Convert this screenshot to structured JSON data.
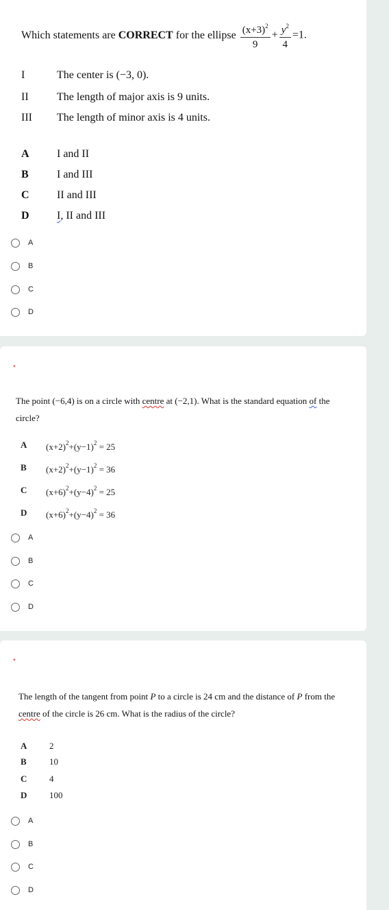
{
  "questions": [
    {
      "prompt_prefix": "Which statements are ",
      "prompt_bold": "CORRECT",
      "prompt_suffix": " for the ellipse",
      "equation": {
        "term1_num": "(x+3)",
        "term1_exp": "2",
        "term1_den": "9",
        "plus": "+",
        "term2_num": "y",
        "term2_exp": "2",
        "term2_den": "4",
        "rhs": "=1."
      },
      "statements": [
        {
          "label": "I",
          "text": "The center is (−3, 0)."
        },
        {
          "label": "II",
          "text": "The length of major axis is 9 units."
        },
        {
          "label": "III",
          "text": "The length of minor axis is 4 units."
        }
      ],
      "options": [
        {
          "label": "A",
          "text": "I and II"
        },
        {
          "label": "B",
          "text": "I and III"
        },
        {
          "label": "C",
          "text": "II and III"
        },
        {
          "label": "D",
          "text_part1": "I",
          "text_part2": ", II and III"
        }
      ],
      "choices": [
        "A",
        "B",
        "C",
        "D"
      ]
    },
    {
      "required_marker": "*",
      "prompt_part1": "The point (−6,4) is on a circle with ",
      "prompt_squiggle": "centre",
      "prompt_part2": " at (−2,1). What is the standard equation ",
      "prompt_squiggle2": "of",
      "prompt_part3": " the circle?",
      "options": [
        {
          "label": "A",
          "lhs1": "(x+2)",
          "lhs2": "+(y−1)",
          "rhs": "= 25"
        },
        {
          "label": "B",
          "lhs1": "(x+2)",
          "lhs2": "+(y−1)",
          "rhs": "= 36"
        },
        {
          "label": "C",
          "lhs1": "(x+6)",
          "lhs2": "+(y−4)",
          "rhs": "= 25"
        },
        {
          "label": "D",
          "lhs1": "(x+6)",
          "lhs2": "+(y−4)",
          "rhs": "= 36"
        }
      ],
      "exp": "2",
      "choices": [
        "A",
        "B",
        "C",
        "D"
      ]
    },
    {
      "required_marker": "*",
      "prompt_part1": "The length of the tangent from point ",
      "var": "P",
      "prompt_part2": " to a circle is 24 cm and the distance of ",
      "prompt_part3": " from the ",
      "prompt_squiggle": "centre",
      "prompt_part4": " of the circle is 26 cm. What is the radius of the circle?",
      "options": [
        {
          "label": "A",
          "text": "2"
        },
        {
          "label": "B",
          "text": "10"
        },
        {
          "label": "C",
          "text": "4"
        },
        {
          "label": "D",
          "text": "100"
        }
      ],
      "choices": [
        "A",
        "B",
        "C",
        "D"
      ]
    }
  ]
}
